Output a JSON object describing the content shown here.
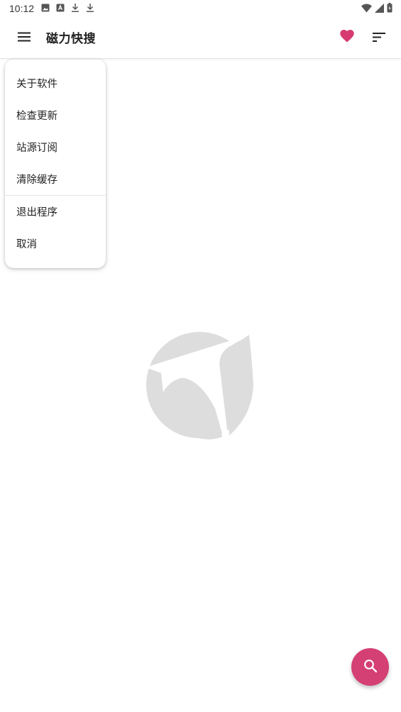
{
  "status_bar": {
    "time": "10:12",
    "left_icons": [
      "image-icon",
      "app-icon",
      "download-icon",
      "download-icon"
    ],
    "right_icons": [
      "wifi-icon",
      "signal-icon",
      "battery-icon"
    ]
  },
  "app_bar": {
    "title": "磁力快搜",
    "menu_icon": "hamburger-menu-icon",
    "favorite_icon": "heart-icon",
    "sort_icon": "sort-icon"
  },
  "dropdown_menu": {
    "items": [
      {
        "label": "关于软件"
      },
      {
        "label": "检查更新"
      },
      {
        "label": "站源订阅"
      },
      {
        "label": "清除缓存"
      },
      {
        "label": "退出程序"
      },
      {
        "label": "取消"
      }
    ]
  },
  "center_logo": {
    "icon": "app-logo-icon"
  },
  "fab": {
    "icon": "search-icon"
  },
  "colors": {
    "accent": "#d43f74",
    "heart": "#d63a70",
    "logo_gray": "#dddddd",
    "text_primary": "#222222"
  }
}
